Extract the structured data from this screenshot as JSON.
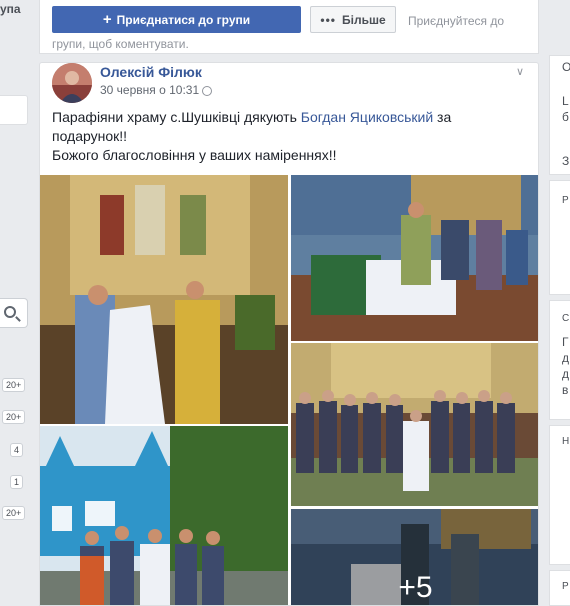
{
  "sidebar": {
    "title_fragment": "упа",
    "badges": [
      "20+",
      "20+",
      "4",
      "1",
      "20+"
    ]
  },
  "join_bar": {
    "join_label": "Приєднатися до групи",
    "more_label": "Більше",
    "hint": "Приєднуйтеся до групи, щоб коментувати."
  },
  "post": {
    "author": "Олексій Філюк",
    "date": "30 червня о 10:31",
    "text_before_link": "Парафіяни храму с.Шушківці дякують ",
    "linked_name": "Богдан Яциковський",
    "text_after_link": " за подарунок!!",
    "line2": "Божого благословіння у ваших наміреннях!!",
    "more_photos": "+5"
  },
  "right_column": {
    "fragments": [
      "О",
      "L",
      "б",
      "З",
      "Р",
      "С",
      "Г",
      "д",
      "д",
      "в",
      "Н",
      "Р"
    ]
  },
  "colors": {
    "accent": "#4267b2",
    "link": "#385898",
    "background": "#e9ebee"
  }
}
